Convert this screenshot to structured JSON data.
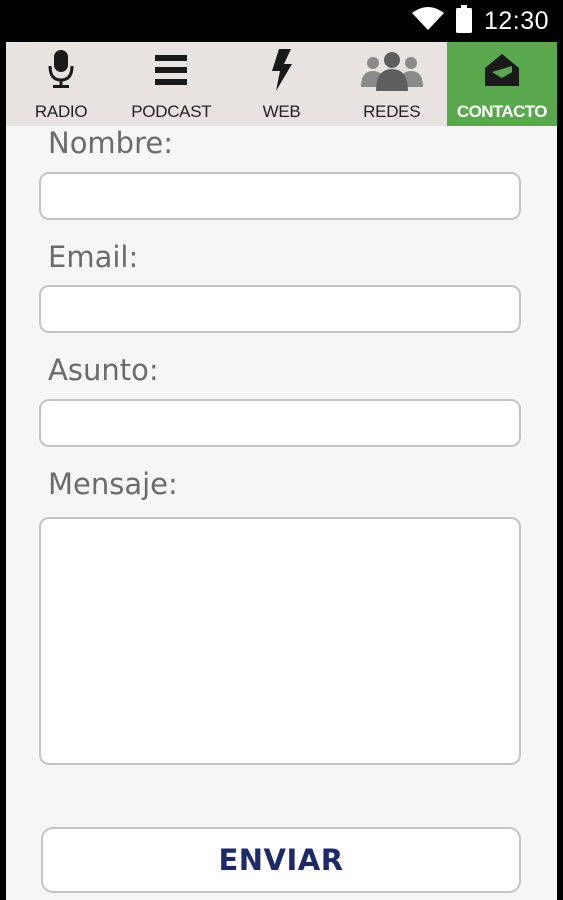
{
  "status_bar": {
    "time": "12:30",
    "icons": [
      "wifi-icon",
      "battery-icon"
    ]
  },
  "nav": {
    "active_color": "#5aa84c",
    "items": [
      {
        "label": "RADIO",
        "icon": "microphone-icon"
      },
      {
        "label": "PODCAST",
        "icon": "list-icon"
      },
      {
        "label": "WEB",
        "icon": "lightning-icon"
      },
      {
        "label": "REDES",
        "icon": "people-icon"
      },
      {
        "label": "CONTACTO",
        "icon": "envelope-icon",
        "active": true
      }
    ]
  },
  "form": {
    "name_label": "Nombre:",
    "name_value": "",
    "email_label": "Email:",
    "email_value": "",
    "subject_label": "Asunto:",
    "subject_value": "",
    "message_label": "Mensaje:",
    "message_value": "",
    "submit_label": "ENVIAR"
  }
}
